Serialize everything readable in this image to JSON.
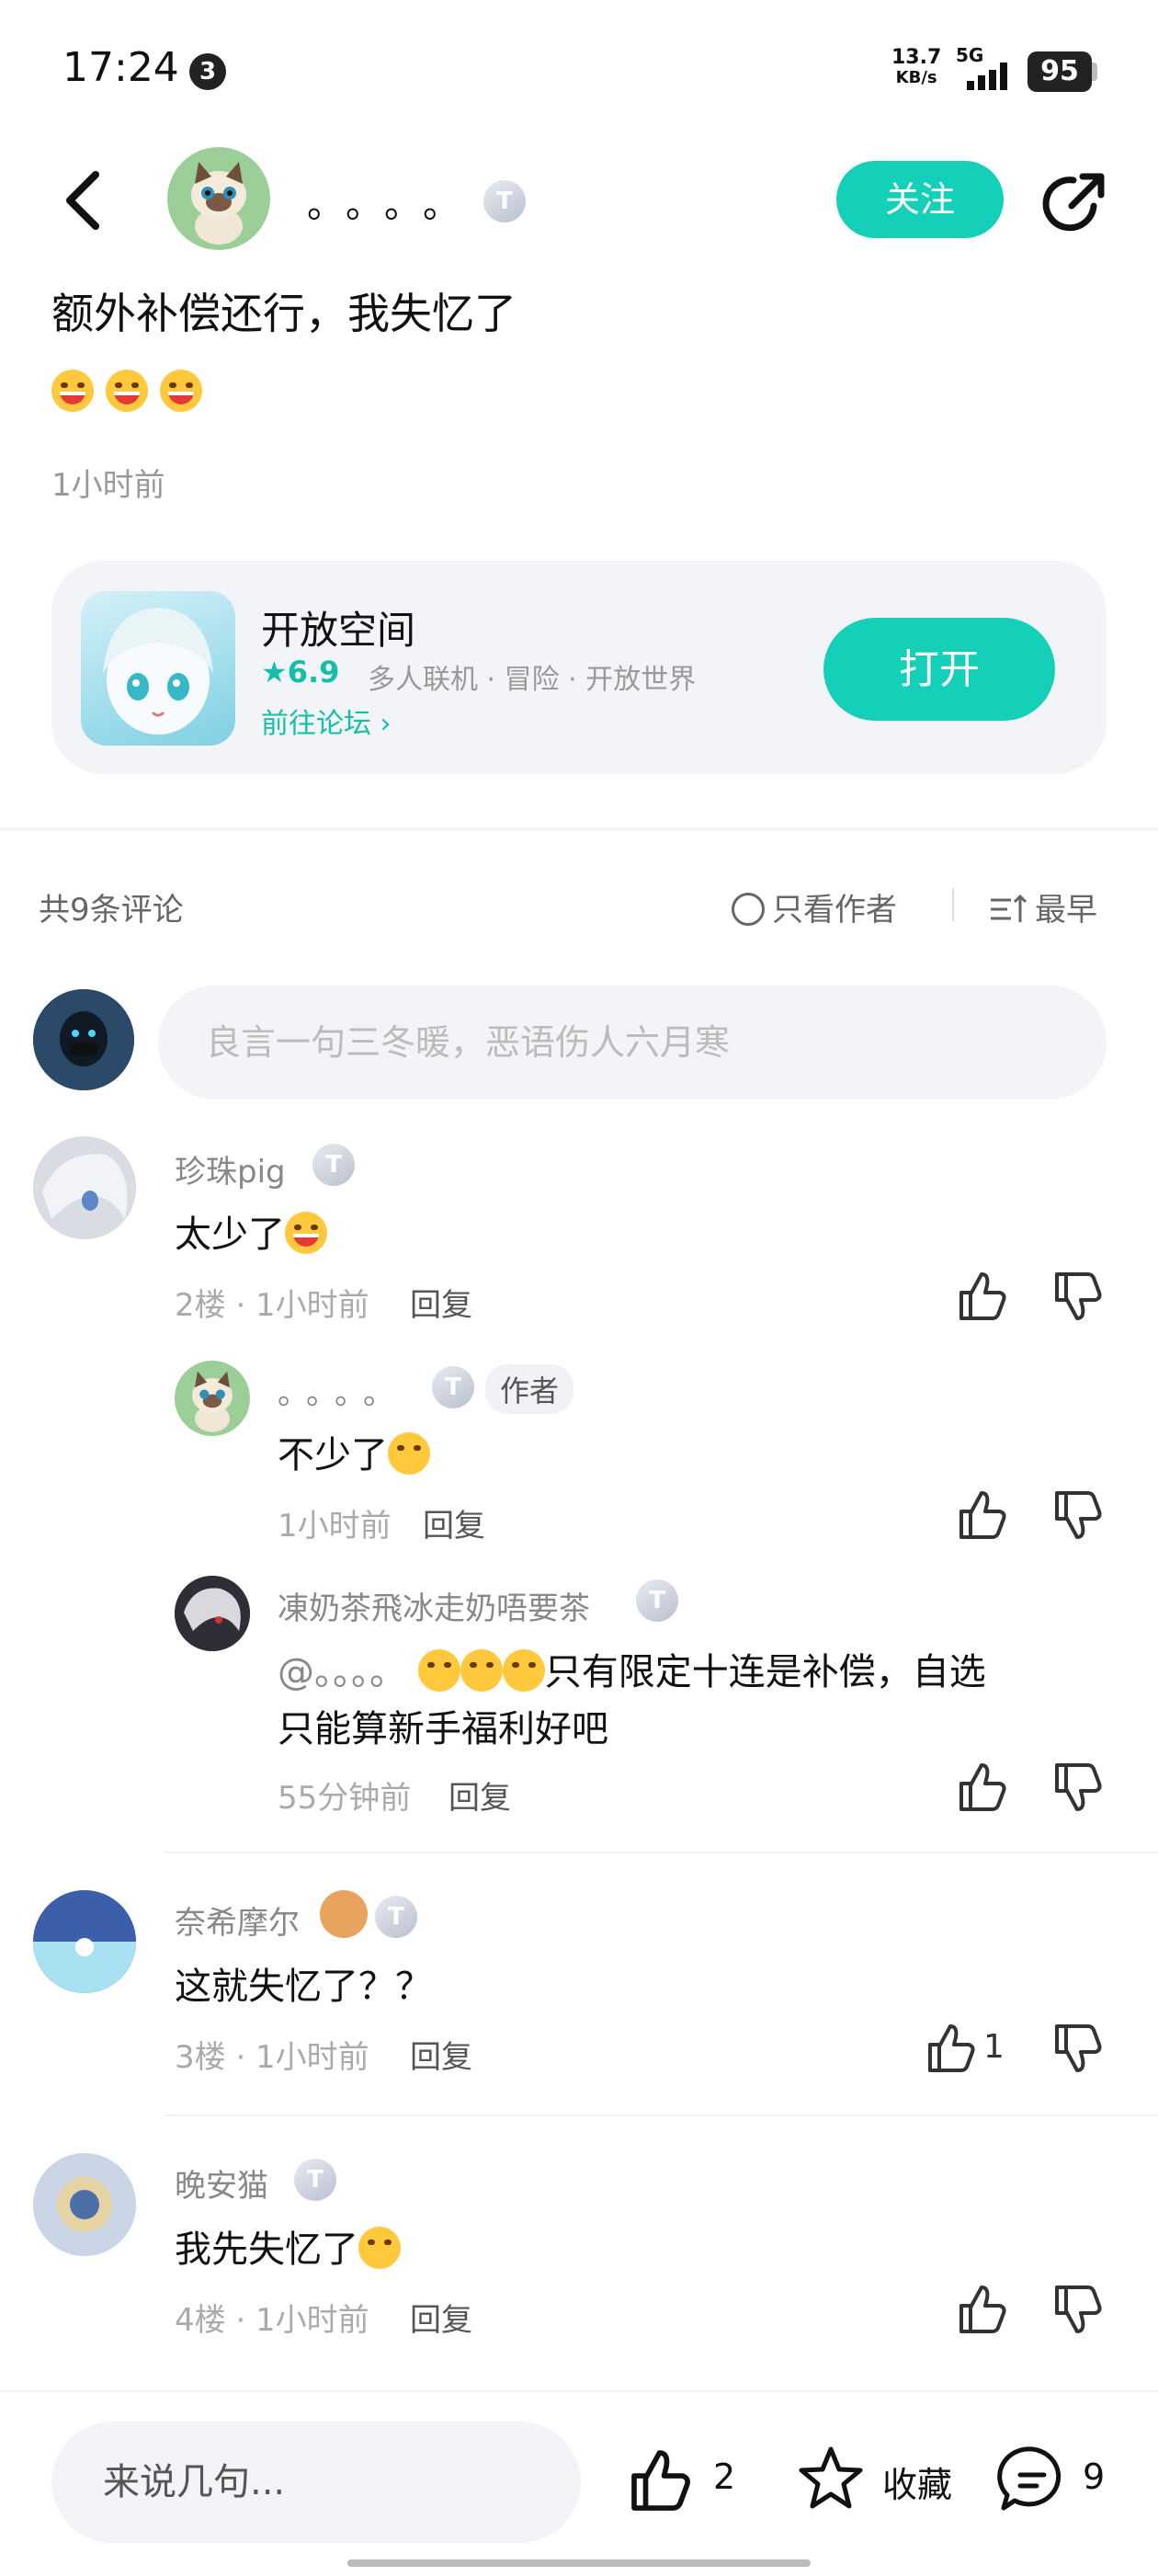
{
  "status_bar": {
    "time": "17:24",
    "notification_count": "3",
    "net_speed_value": "13.7",
    "net_speed_unit": "KB/s",
    "network": "5G",
    "battery": "95"
  },
  "header": {
    "author_name": "。。。。",
    "author_level": "T",
    "follow_label": "关注"
  },
  "post": {
    "title": "额外补偿还行，我失忆了",
    "time": "1小时前"
  },
  "app_card": {
    "name": "开放空间",
    "rating": "★6.9",
    "tags": "多人联机 · 冒险 · 开放世界",
    "forum_link": "前往论坛 ›",
    "open_label": "打开"
  },
  "comments_header": {
    "count_text": "共9条评论",
    "only_author_label": "只看作者",
    "sort_label": "最早"
  },
  "comment_input": {
    "placeholder": "良言一句三冬暖，恶语伤人六月寒"
  },
  "comments": [
    {
      "name": "珍珠pig",
      "text": "太少了",
      "floor": "2楼 · 1小时前",
      "reply_label": "回复",
      "replies": [
        {
          "name": "。。。。",
          "author_tag": "作者",
          "text": "不少了",
          "meta": "1小时前",
          "reply_label": "回复"
        },
        {
          "name": "凍奶茶飛冰走奶唔要茶",
          "text_prefix": "@。。。。",
          "text_line1": "只有限定十连是补偿，自选",
          "text_line2": "只能算新手福利好吧",
          "meta": "55分钟前",
          "reply_label": "回复"
        }
      ]
    },
    {
      "name": "奈希摩尔",
      "text": "这就失忆了？？",
      "floor": "3楼 · 1小时前",
      "reply_label": "回复",
      "like_count": "1"
    },
    {
      "name": "晚安猫",
      "text": "我先失忆了",
      "floor": "4楼 · 1小时前",
      "reply_label": "回复"
    }
  ],
  "bottom_bar": {
    "input_placeholder": "来说几句...",
    "like_count": "2",
    "favorite_label": "收藏",
    "comment_count": "9"
  },
  "colors": {
    "accent": "#14d0b8",
    "text_primary": "#111111",
    "text_secondary": "#999999"
  }
}
